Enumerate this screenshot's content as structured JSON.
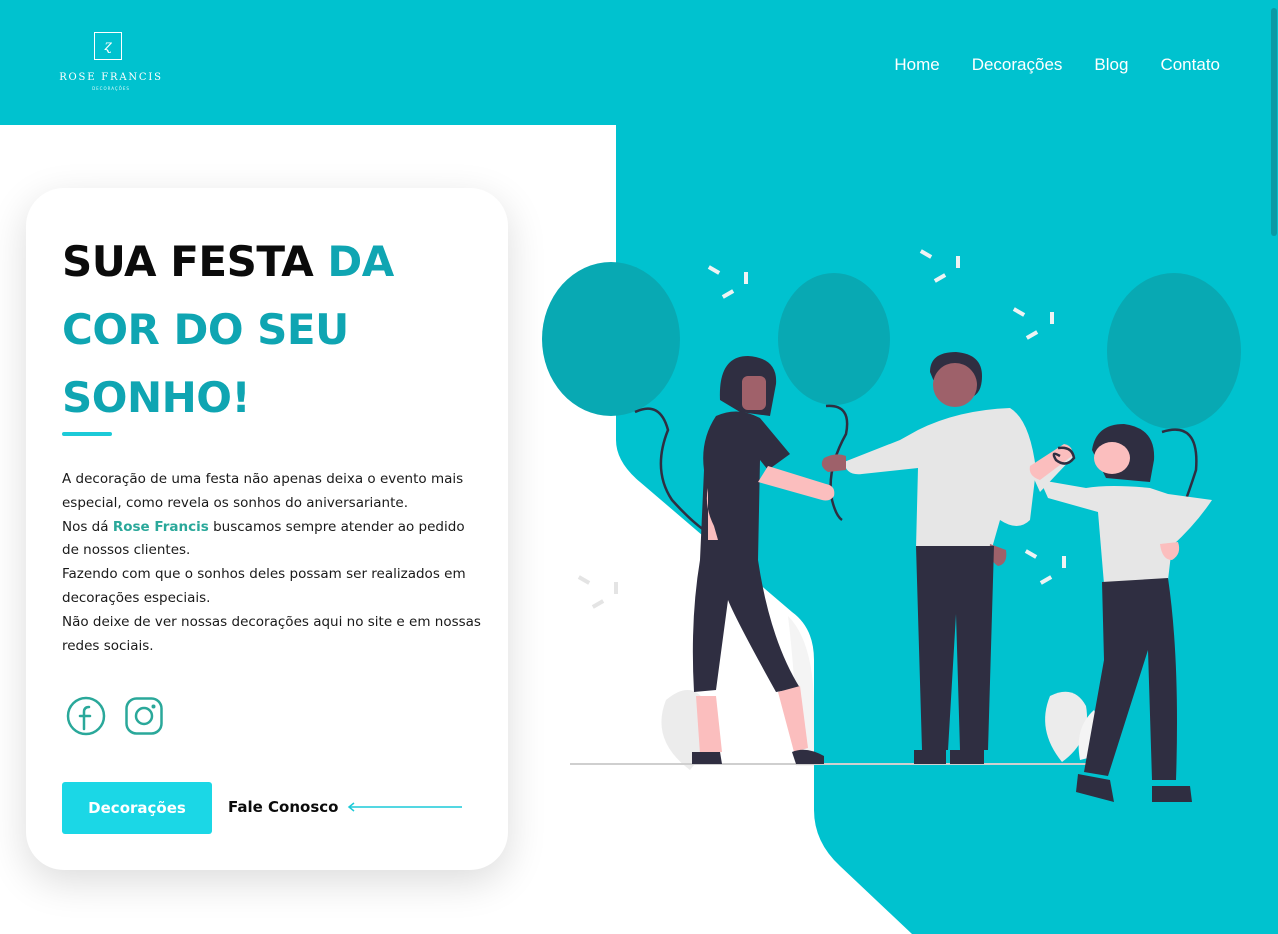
{
  "colors": {
    "primary": "#00c2cf",
    "title_dark": "#0b0b0b",
    "title_teal": "#0fa5b2",
    "brand_highlight": "#2aa89a",
    "button": "#1bd7e6"
  },
  "header": {
    "logo": {
      "name": "ROSE FRANCIS",
      "subtitle": "DECORAÇÕES"
    },
    "nav": [
      "Home",
      "Decorações",
      "Blog",
      "Contato"
    ]
  },
  "hero": {
    "title_dark": "SUA FESTA",
    "title_teal_1": "DA",
    "title_teal_2": "COR DO SEU",
    "title_teal_3": "SONHO!",
    "description": {
      "line1": "A decoração de uma festa não apenas deixa o evento mais especial, como revela os sonhos do aniversariante.",
      "line2_before": "Nos dá",
      "line2_brand": "Rose Francis",
      "line2_after": "buscamos sempre atender ao pedido de nossos clientes.",
      "line3": "Fazendo com que o sonhos deles possam ser realizados em decorações especiais.",
      "line4": "Não deixe de ver nossas decorações aqui no site e em nossas redes sociais."
    },
    "socials": [
      {
        "name": "facebook-icon"
      },
      {
        "name": "instagram-icon"
      }
    ],
    "primary_button": "Decorações",
    "secondary_link": "Fale Conosco"
  }
}
